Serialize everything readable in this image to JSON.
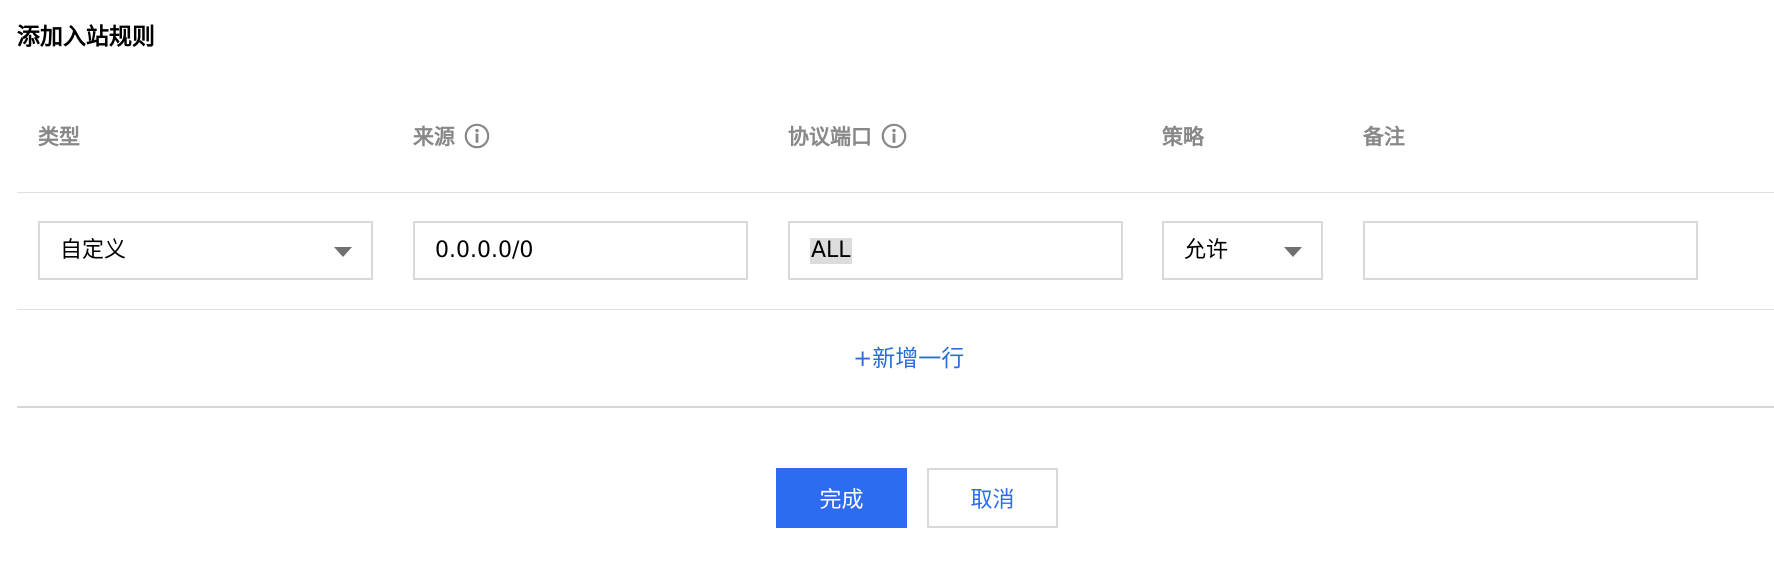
{
  "dialog": {
    "title": "添加入站规则"
  },
  "table": {
    "headers": {
      "type": "类型",
      "source": "来源",
      "protocol_port": "协议端口",
      "policy": "策略",
      "remark": "备注"
    },
    "row": {
      "type_value": "自定义",
      "source_value": "0.0.0.0/0",
      "protocol_port_value": "ALL",
      "policy_value": "允许",
      "remark_value": ""
    },
    "add_row_label": "+新增一行"
  },
  "footer": {
    "confirm_label": "完成",
    "cancel_label": "取消"
  },
  "colors": {
    "primary": "#2d6cf0",
    "link": "#2b6fd6",
    "header_text": "#888888",
    "border": "#d9d9d9"
  },
  "icons": {
    "info": "info-circle-icon",
    "dropdown": "caret-down-icon"
  }
}
